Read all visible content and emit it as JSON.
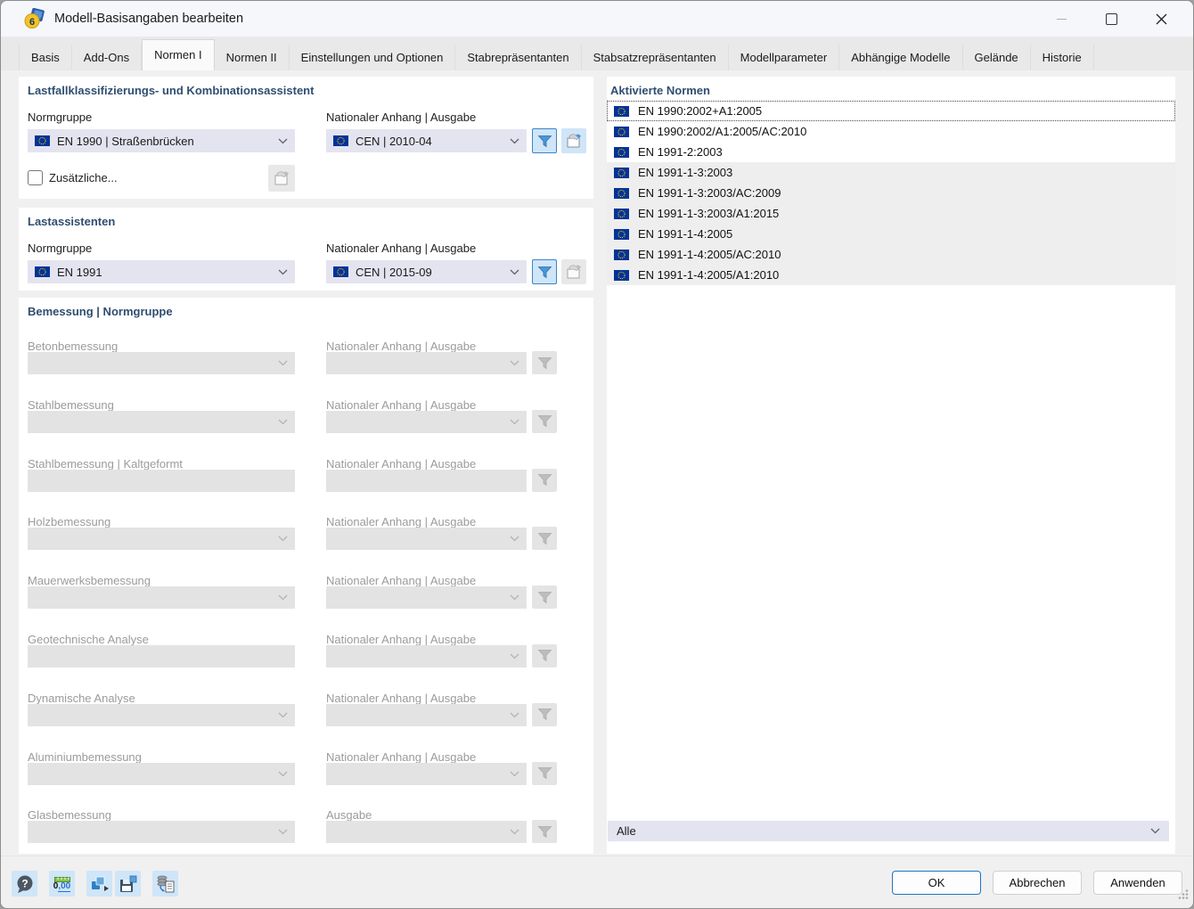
{
  "window": {
    "title": "Modell-Basisangaben bearbeiten"
  },
  "tabs": [
    {
      "label": "Basis",
      "active": false
    },
    {
      "label": "Add-Ons",
      "active": false
    },
    {
      "label": "Normen I",
      "active": true
    },
    {
      "label": "Normen II",
      "active": false
    },
    {
      "label": "Einstellungen und Optionen",
      "active": false
    },
    {
      "label": "Stabrepräsentanten",
      "active": false
    },
    {
      "label": "Stabsatzrepräsentanten",
      "active": false
    },
    {
      "label": "Modellparameter",
      "active": false
    },
    {
      "label": "Abhängige Modelle",
      "active": false
    },
    {
      "label": "Gelände",
      "active": false
    },
    {
      "label": "Historie",
      "active": false
    }
  ],
  "classification": {
    "title": "Lastfallklassifizierungs- und Kombinationsassistent",
    "normgruppe_label": "Normgruppe",
    "normgruppe_value": "EN 1990 | Straßenbrücken",
    "annex_label": "Nationaler Anhang | Ausgabe",
    "annex_value": "CEN | 2010-04",
    "checkbox_label": "Zusätzliche...",
    "checkbox_checked": false
  },
  "load_wizards": {
    "title": "Lastassistenten",
    "normgruppe_label": "Normgruppe",
    "normgruppe_value": "EN 1991",
    "annex_label": "Nationaler Anhang | Ausgabe",
    "annex_value": "CEN | 2015-09"
  },
  "design": {
    "title": "Bemessung | Normgruppe",
    "rows": [
      {
        "label": "Betonbemessung",
        "right_label": "Nationaler Anhang | Ausgabe",
        "left_combo": true,
        "right_combo": true
      },
      {
        "label": "Stahlbemessung",
        "right_label": "Nationaler Anhang | Ausgabe",
        "left_combo": true,
        "right_combo": true
      },
      {
        "label": "Stahlbemessung | Kaltgeformt",
        "right_label": "Nationaler Anhang | Ausgabe",
        "left_combo": false,
        "right_combo": false
      },
      {
        "label": "Holzbemessung",
        "right_label": "Nationaler Anhang | Ausgabe",
        "left_combo": true,
        "right_combo": true
      },
      {
        "label": "Mauerwerksbemessung",
        "right_label": "Nationaler Anhang | Ausgabe",
        "left_combo": true,
        "right_combo": true
      },
      {
        "label": "Geotechnische Analyse",
        "right_label": "Nationaler Anhang | Ausgabe",
        "left_combo": false,
        "right_combo": true
      },
      {
        "label": "Dynamische Analyse",
        "right_label": "Nationaler Anhang | Ausgabe",
        "left_combo": true,
        "right_combo": true
      },
      {
        "label": "Aluminiumbemessung",
        "right_label": "Nationaler Anhang | Ausgabe",
        "left_combo": true,
        "right_combo": true
      },
      {
        "label": "Glasbemessung",
        "right_label": "Ausgabe",
        "left_combo": true,
        "right_combo": true
      }
    ]
  },
  "activated_norms": {
    "title": "Aktivierte Normen",
    "items": [
      {
        "label": "EN 1990:2002+A1:2005",
        "focused": true,
        "shaded": false
      },
      {
        "label": "EN 1990:2002/A1:2005/AC:2010",
        "focused": false,
        "shaded": false
      },
      {
        "label": "EN 1991-2:2003",
        "focused": false,
        "shaded": false
      },
      {
        "label": "EN 1991-1-3:2003",
        "focused": false,
        "shaded": true
      },
      {
        "label": "EN 1991-1-3:2003/AC:2009",
        "focused": false,
        "shaded": true
      },
      {
        "label": "EN 1991-1-3:2003/A1:2015",
        "focused": false,
        "shaded": true
      },
      {
        "label": "EN 1991-1-4:2005",
        "focused": false,
        "shaded": true
      },
      {
        "label": "EN 1991-1-4:2005/AC:2010",
        "focused": false,
        "shaded": true
      },
      {
        "label": "EN 1991-1-4:2005/A1:2010",
        "focused": false,
        "shaded": true
      }
    ],
    "filter_value": "Alle"
  },
  "footer": {
    "units_label": "0,00",
    "ok": "OK",
    "cancel": "Abbrechen",
    "apply": "Anwenden"
  },
  "colors": {
    "accent": "#1d74c8",
    "eu_flag_blue": "#003399",
    "eu_star_yellow": "#ffcc00",
    "filter_blue": "#4a97d8",
    "section_header": "#2f4e71"
  }
}
